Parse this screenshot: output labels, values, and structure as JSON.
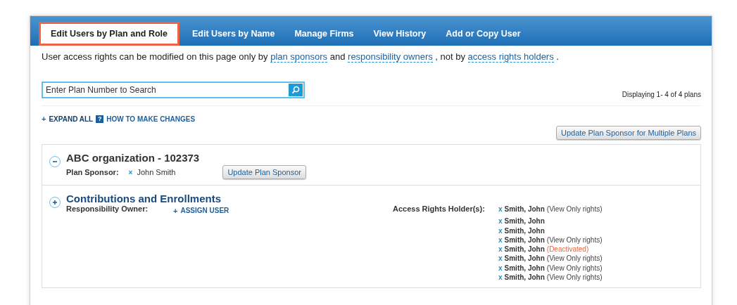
{
  "tabs": [
    {
      "label": "Edit Users by Plan and Role",
      "selected": true
    },
    {
      "label": "Edit Users by Name",
      "selected": false
    },
    {
      "label": "Manage Firms",
      "selected": false
    },
    {
      "label": "View History",
      "selected": false
    },
    {
      "label": "Add or Copy User",
      "selected": false
    }
  ],
  "intro": [
    {
      "text": "User access rights can be modified on this page only by ",
      "link": false
    },
    {
      "text": "plan sponsors",
      "link": true
    },
    {
      "text": " and ",
      "link": false
    },
    {
      "text": "responsibility owners",
      "link": true
    },
    {
      "text": " , not by ",
      "link": false
    },
    {
      "text": "access rights holders",
      "link": true
    },
    {
      "text": " .",
      "link": false
    }
  ],
  "search": {
    "placeholder": "Enter Plan Number to Search"
  },
  "display_count": "Displaying 1- 4 of 4 plans",
  "expand_all": {
    "icon": "+",
    "label": "EXPAND ALL"
  },
  "help_link": {
    "icon": "?",
    "label": "HOW TO MAKE CHANGES"
  },
  "multi_button": "Update Plan Sponsor for Multiple Plans",
  "plan": {
    "title": "ABC organization - 102373",
    "expanded": true,
    "sponsor_label": "Plan Sponsor:",
    "sponsor_remove": "×",
    "sponsor": "John Smith",
    "sponsor_button": "Update Plan Sponsor"
  },
  "section": {
    "title": "Contributions and Enrollments",
    "expanded": false,
    "owner_label": "Responsibility Owner:",
    "assign": {
      "icon": "+",
      "label": "ASSIGN USER"
    },
    "holders_label": "Access Rights Holder(s):",
    "holders": [
      {
        "remove": "x",
        "name": "Smith, John",
        "note": "(View Only rights)",
        "kind": "normal"
      },
      {
        "remove": "x",
        "name": "Smith, John"
      },
      {
        "remove": "x",
        "name": "Smith, John"
      },
      {
        "remove": "x",
        "name": "Smith, John",
        "note": "(View Only rights)",
        "kind": "normal"
      },
      {
        "remove": "x",
        "name": "Smith, John",
        "note": "(Deactivated)",
        "kind": "deactivated"
      },
      {
        "remove": "x",
        "name": "Smith, John",
        "note": "(View Only rights)",
        "kind": "normal"
      },
      {
        "remove": "x",
        "name": "Smith, John",
        "note": "(View Only rights)",
        "kind": "normal"
      },
      {
        "remove": "x",
        "name": "Smith, John",
        "note": "(View Only rights)",
        "kind": "normal"
      }
    ]
  }
}
